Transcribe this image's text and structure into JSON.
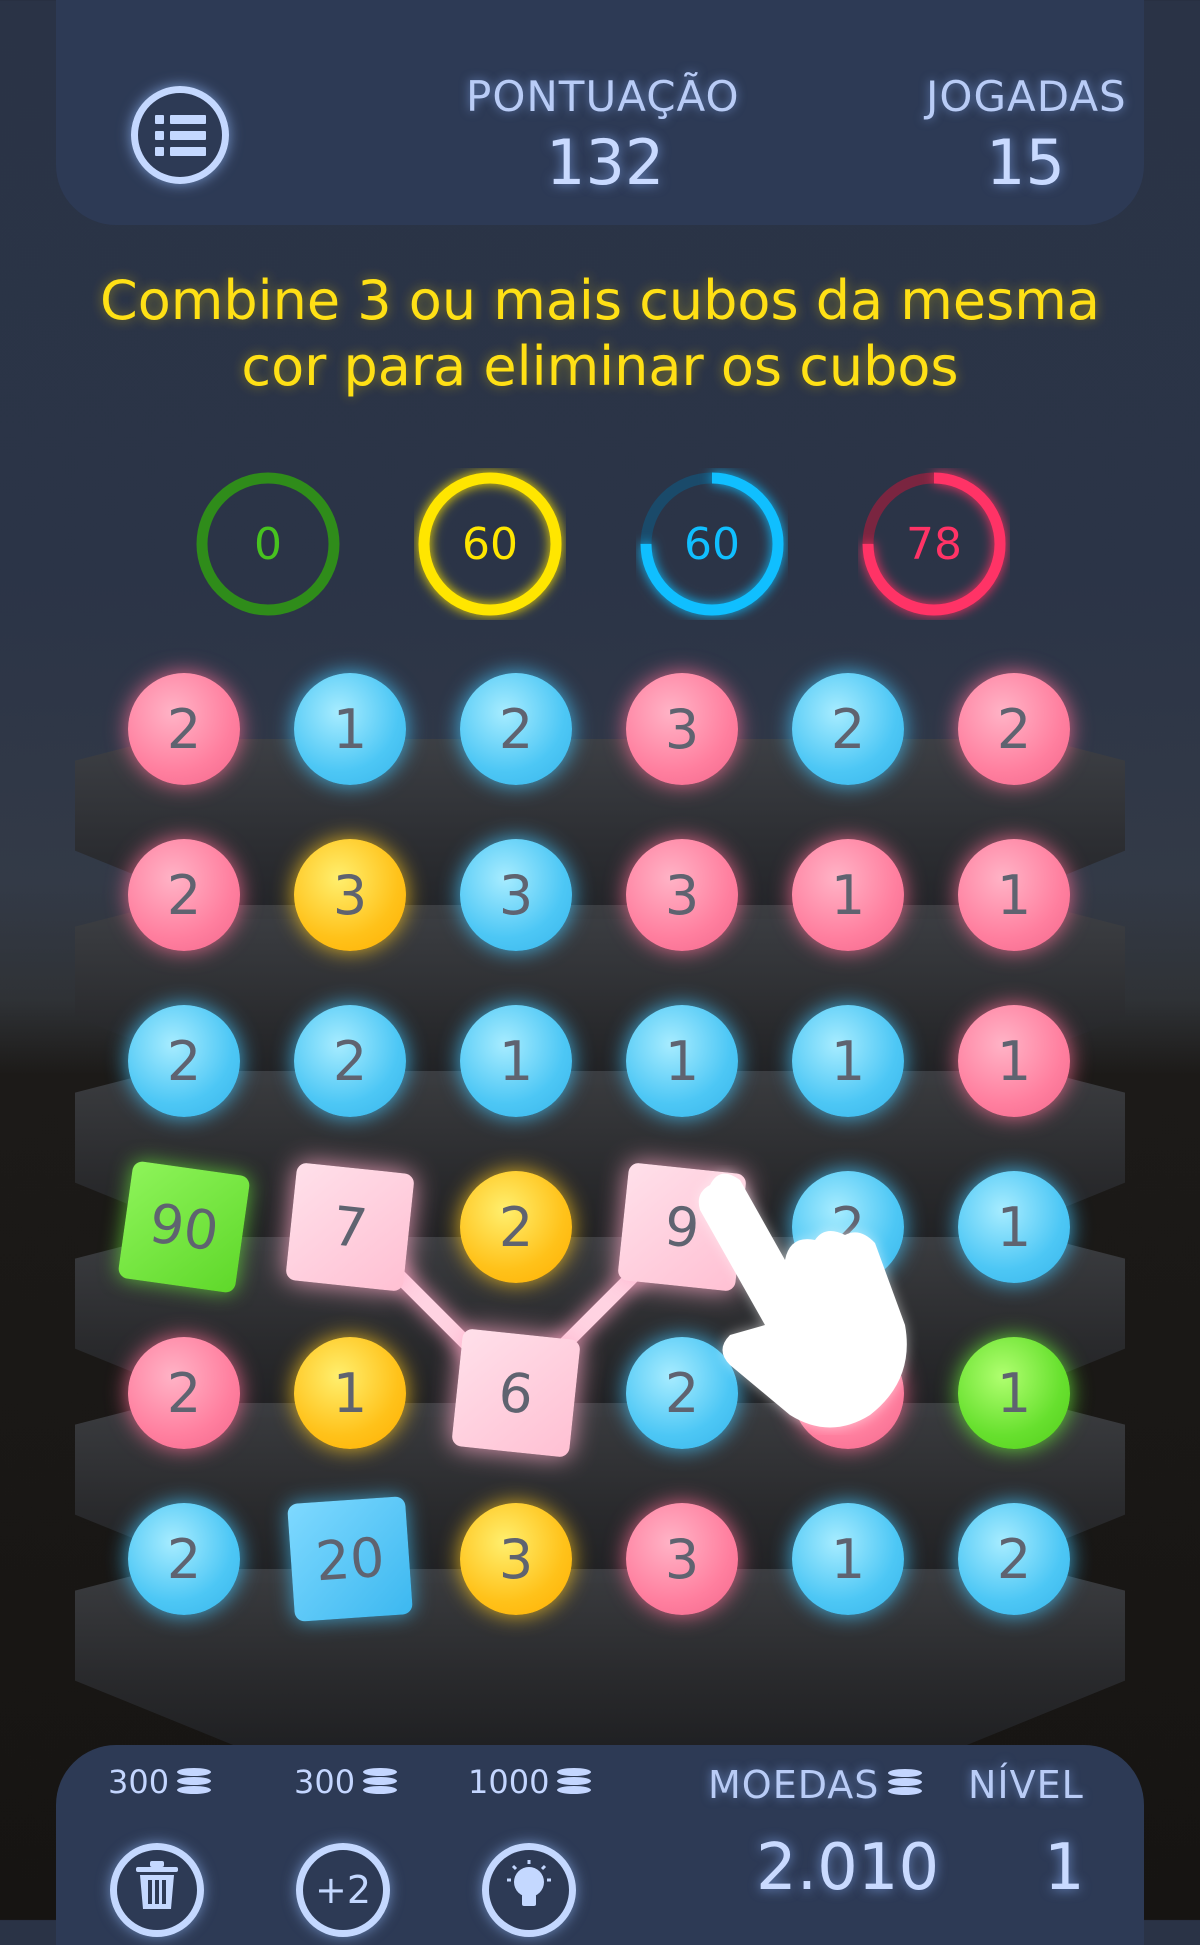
{
  "header": {
    "menu_icon": "list-icon",
    "score_label": "PONTUAÇÃO",
    "score_value": "132",
    "moves_label": "JOGADAS",
    "moves_value": "15"
  },
  "instruction": {
    "line1": "Combine 3 ou mais cubos da mesma",
    "line2": "cor para eliminar os cubos"
  },
  "goals": [
    {
      "color": "green",
      "hex": "#2f8c1a",
      "value": "0",
      "progress": 0.0
    },
    {
      "color": "yellow",
      "hex": "#ffe600",
      "value": "60",
      "progress": 1.0
    },
    {
      "color": "blue",
      "hex": "#10bfff",
      "value": "60",
      "progress": 0.75
    },
    {
      "color": "red",
      "hex": "#ff3366",
      "value": "78",
      "progress": 0.75
    }
  ],
  "grid": [
    [
      {
        "t": "ball",
        "c": "pink",
        "v": "2"
      },
      {
        "t": "ball",
        "c": "blue",
        "v": "1"
      },
      {
        "t": "ball",
        "c": "blue",
        "v": "2"
      },
      {
        "t": "ball",
        "c": "pink",
        "v": "3"
      },
      {
        "t": "ball",
        "c": "blue",
        "v": "2"
      },
      {
        "t": "ball",
        "c": "pink",
        "v": "2"
      }
    ],
    [
      {
        "t": "ball",
        "c": "pink",
        "v": "2"
      },
      {
        "t": "ball",
        "c": "yellow",
        "v": "3"
      },
      {
        "t": "ball",
        "c": "blue",
        "v": "3"
      },
      {
        "t": "ball",
        "c": "pink",
        "v": "3"
      },
      {
        "t": "ball",
        "c": "pink",
        "v": "1"
      },
      {
        "t": "ball",
        "c": "pink",
        "v": "1"
      }
    ],
    [
      {
        "t": "ball",
        "c": "blue",
        "v": "2"
      },
      {
        "t": "ball",
        "c": "blue",
        "v": "2"
      },
      {
        "t": "ball",
        "c": "blue",
        "v": "1"
      },
      {
        "t": "ball",
        "c": "blue",
        "v": "1"
      },
      {
        "t": "ball",
        "c": "blue",
        "v": "1"
      },
      {
        "t": "ball",
        "c": "pink",
        "v": "1"
      }
    ],
    [
      {
        "t": "cube",
        "c": "green",
        "v": "90"
      },
      {
        "t": "cube",
        "c": "pink",
        "v": "7"
      },
      {
        "t": "ball",
        "c": "yellow",
        "v": "2"
      },
      {
        "t": "cube",
        "c": "pink",
        "v": "9"
      },
      {
        "t": "ball",
        "c": "blue",
        "v": "2"
      },
      {
        "t": "ball",
        "c": "blue",
        "v": "1"
      }
    ],
    [
      {
        "t": "ball",
        "c": "pink",
        "v": "2"
      },
      {
        "t": "ball",
        "c": "yellow",
        "v": "1"
      },
      {
        "t": "cube",
        "c": "pink",
        "v": "6"
      },
      {
        "t": "ball",
        "c": "blue",
        "v": "2"
      },
      {
        "t": "ball",
        "c": "pink",
        "v": ""
      },
      {
        "t": "ball",
        "c": "green",
        "v": "1"
      }
    ],
    [
      {
        "t": "ball",
        "c": "blue",
        "v": "2"
      },
      {
        "t": "cube",
        "c": "blue",
        "v": "20"
      },
      {
        "t": "ball",
        "c": "yellow",
        "v": "3"
      },
      {
        "t": "ball",
        "c": "pink",
        "v": "3"
      },
      {
        "t": "ball",
        "c": "blue",
        "v": "1"
      },
      {
        "t": "ball",
        "c": "blue",
        "v": "2"
      }
    ]
  ],
  "powerups": [
    {
      "price": "300",
      "icon": "trash-icon",
      "label": ""
    },
    {
      "price": "300",
      "icon": "plus-two-icon",
      "label": "+2"
    },
    {
      "price": "1000",
      "icon": "lightbulb-icon",
      "label": ""
    }
  ],
  "footer": {
    "coins_label": "MOEDAS",
    "coins_value": "2.010",
    "level_label": "NÍVEL",
    "level_value": "1"
  }
}
